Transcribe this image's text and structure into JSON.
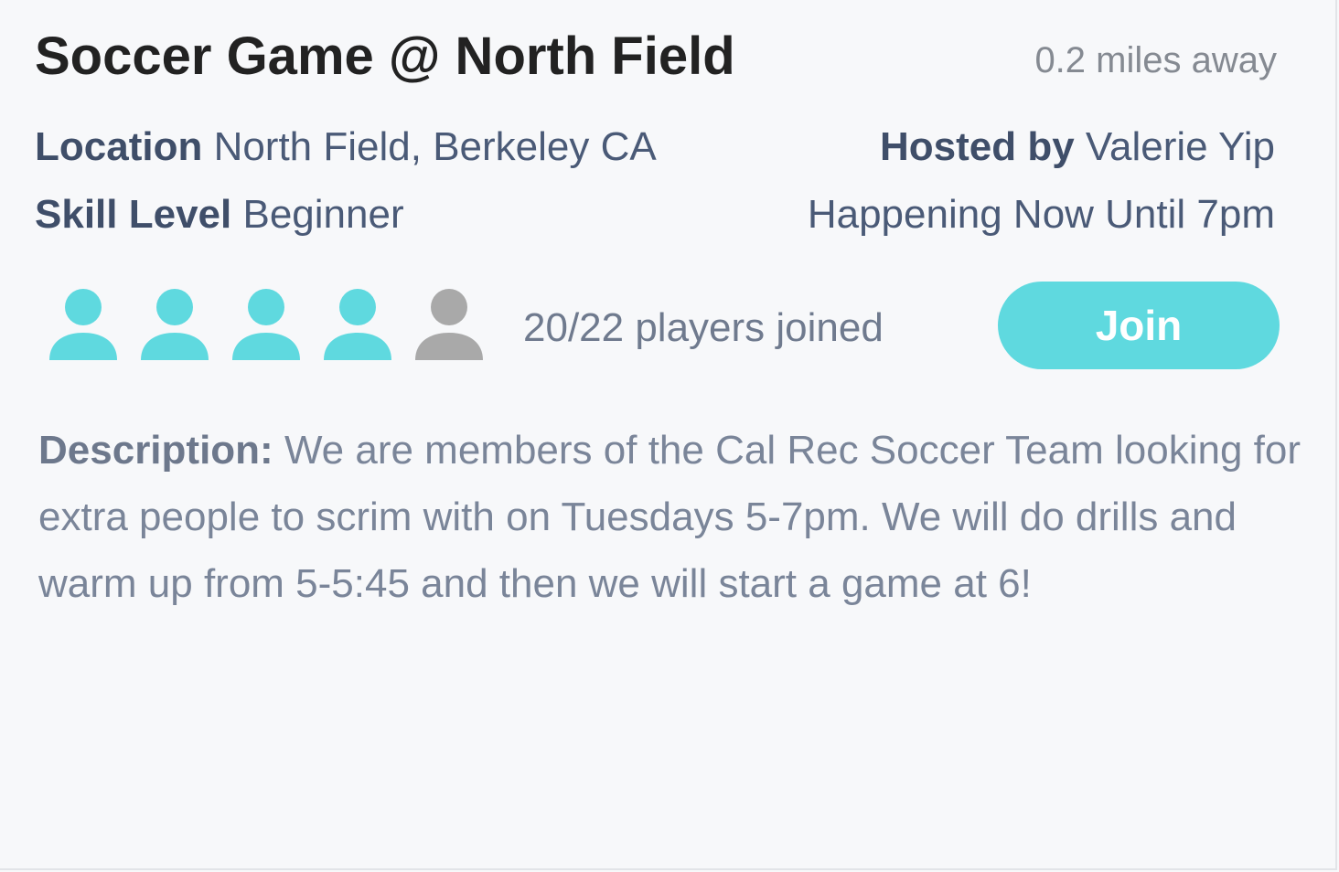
{
  "event": {
    "title": "Soccer Game @ North Field",
    "distance": "0.2 miles away"
  },
  "details": {
    "location_label": "Location",
    "location_value": "North Field, Berkeley CA",
    "host_label": "Hosted by",
    "host_value": "Valerie Yip",
    "skill_label": "Skill Level",
    "skill_value": "Beginner",
    "time_text": "Happening Now Until 7pm"
  },
  "players": {
    "joined_text": "20/22 players joined",
    "icons": [
      {
        "icon": "person-icon",
        "state": "joined"
      },
      {
        "icon": "person-icon",
        "state": "joined"
      },
      {
        "icon": "person-icon",
        "state": "joined"
      },
      {
        "icon": "person-icon",
        "state": "joined"
      },
      {
        "icon": "person-icon",
        "state": "open"
      }
    ]
  },
  "actions": {
    "join_label": "Join"
  },
  "description": {
    "label": "Description:",
    "text": "We are members of the Cal Rec Soccer Team looking for extra people to scrim with on Tuesdays 5-7pm. We will do drills and warm up from 5-5:45 and then we will start a game at 6!"
  },
  "colors": {
    "accent": "#5fd9df",
    "joined_icon": "#5fd9df",
    "open_icon": "#a9a9a9",
    "label_text": "#3f4e69",
    "value_text": "#4a5a77",
    "title_text": "#222222"
  }
}
